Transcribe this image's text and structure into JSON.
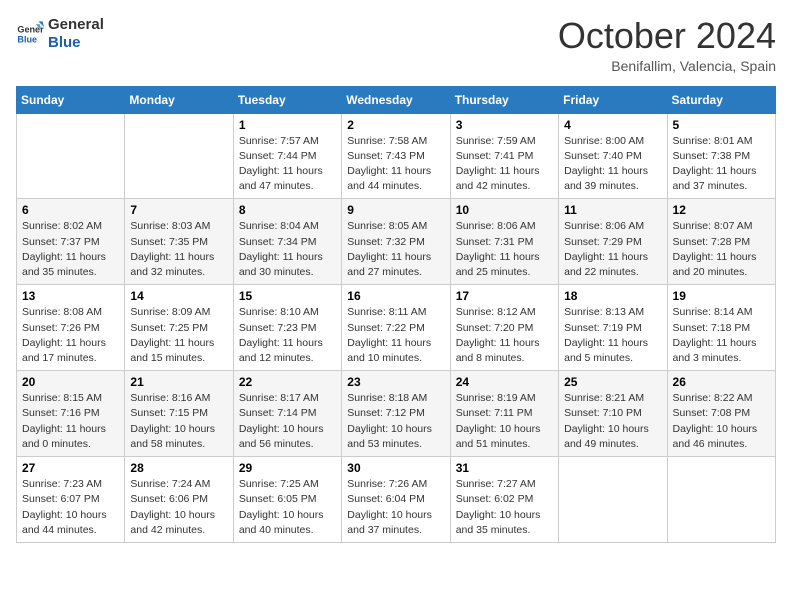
{
  "logo": {
    "line1": "General",
    "line2": "Blue"
  },
  "title": "October 2024",
  "location": "Benifallim, Valencia, Spain",
  "weekdays": [
    "Sunday",
    "Monday",
    "Tuesday",
    "Wednesday",
    "Thursday",
    "Friday",
    "Saturday"
  ],
  "weeks": [
    [
      {
        "day": "",
        "info": ""
      },
      {
        "day": "",
        "info": ""
      },
      {
        "day": "1",
        "info": "Sunrise: 7:57 AM\nSunset: 7:44 PM\nDaylight: 11 hours and 47 minutes."
      },
      {
        "day": "2",
        "info": "Sunrise: 7:58 AM\nSunset: 7:43 PM\nDaylight: 11 hours and 44 minutes."
      },
      {
        "day": "3",
        "info": "Sunrise: 7:59 AM\nSunset: 7:41 PM\nDaylight: 11 hours and 42 minutes."
      },
      {
        "day": "4",
        "info": "Sunrise: 8:00 AM\nSunset: 7:40 PM\nDaylight: 11 hours and 39 minutes."
      },
      {
        "day": "5",
        "info": "Sunrise: 8:01 AM\nSunset: 7:38 PM\nDaylight: 11 hours and 37 minutes."
      }
    ],
    [
      {
        "day": "6",
        "info": "Sunrise: 8:02 AM\nSunset: 7:37 PM\nDaylight: 11 hours and 35 minutes."
      },
      {
        "day": "7",
        "info": "Sunrise: 8:03 AM\nSunset: 7:35 PM\nDaylight: 11 hours and 32 minutes."
      },
      {
        "day": "8",
        "info": "Sunrise: 8:04 AM\nSunset: 7:34 PM\nDaylight: 11 hours and 30 minutes."
      },
      {
        "day": "9",
        "info": "Sunrise: 8:05 AM\nSunset: 7:32 PM\nDaylight: 11 hours and 27 minutes."
      },
      {
        "day": "10",
        "info": "Sunrise: 8:06 AM\nSunset: 7:31 PM\nDaylight: 11 hours and 25 minutes."
      },
      {
        "day": "11",
        "info": "Sunrise: 8:06 AM\nSunset: 7:29 PM\nDaylight: 11 hours and 22 minutes."
      },
      {
        "day": "12",
        "info": "Sunrise: 8:07 AM\nSunset: 7:28 PM\nDaylight: 11 hours and 20 minutes."
      }
    ],
    [
      {
        "day": "13",
        "info": "Sunrise: 8:08 AM\nSunset: 7:26 PM\nDaylight: 11 hours and 17 minutes."
      },
      {
        "day": "14",
        "info": "Sunrise: 8:09 AM\nSunset: 7:25 PM\nDaylight: 11 hours and 15 minutes."
      },
      {
        "day": "15",
        "info": "Sunrise: 8:10 AM\nSunset: 7:23 PM\nDaylight: 11 hours and 12 minutes."
      },
      {
        "day": "16",
        "info": "Sunrise: 8:11 AM\nSunset: 7:22 PM\nDaylight: 11 hours and 10 minutes."
      },
      {
        "day": "17",
        "info": "Sunrise: 8:12 AM\nSunset: 7:20 PM\nDaylight: 11 hours and 8 minutes."
      },
      {
        "day": "18",
        "info": "Sunrise: 8:13 AM\nSunset: 7:19 PM\nDaylight: 11 hours and 5 minutes."
      },
      {
        "day": "19",
        "info": "Sunrise: 8:14 AM\nSunset: 7:18 PM\nDaylight: 11 hours and 3 minutes."
      }
    ],
    [
      {
        "day": "20",
        "info": "Sunrise: 8:15 AM\nSunset: 7:16 PM\nDaylight: 11 hours and 0 minutes."
      },
      {
        "day": "21",
        "info": "Sunrise: 8:16 AM\nSunset: 7:15 PM\nDaylight: 10 hours and 58 minutes."
      },
      {
        "day": "22",
        "info": "Sunrise: 8:17 AM\nSunset: 7:14 PM\nDaylight: 10 hours and 56 minutes."
      },
      {
        "day": "23",
        "info": "Sunrise: 8:18 AM\nSunset: 7:12 PM\nDaylight: 10 hours and 53 minutes."
      },
      {
        "day": "24",
        "info": "Sunrise: 8:19 AM\nSunset: 7:11 PM\nDaylight: 10 hours and 51 minutes."
      },
      {
        "day": "25",
        "info": "Sunrise: 8:21 AM\nSunset: 7:10 PM\nDaylight: 10 hours and 49 minutes."
      },
      {
        "day": "26",
        "info": "Sunrise: 8:22 AM\nSunset: 7:08 PM\nDaylight: 10 hours and 46 minutes."
      }
    ],
    [
      {
        "day": "27",
        "info": "Sunrise: 7:23 AM\nSunset: 6:07 PM\nDaylight: 10 hours and 44 minutes."
      },
      {
        "day": "28",
        "info": "Sunrise: 7:24 AM\nSunset: 6:06 PM\nDaylight: 10 hours and 42 minutes."
      },
      {
        "day": "29",
        "info": "Sunrise: 7:25 AM\nSunset: 6:05 PM\nDaylight: 10 hours and 40 minutes."
      },
      {
        "day": "30",
        "info": "Sunrise: 7:26 AM\nSunset: 6:04 PM\nDaylight: 10 hours and 37 minutes."
      },
      {
        "day": "31",
        "info": "Sunrise: 7:27 AM\nSunset: 6:02 PM\nDaylight: 10 hours and 35 minutes."
      },
      {
        "day": "",
        "info": ""
      },
      {
        "day": "",
        "info": ""
      }
    ]
  ]
}
